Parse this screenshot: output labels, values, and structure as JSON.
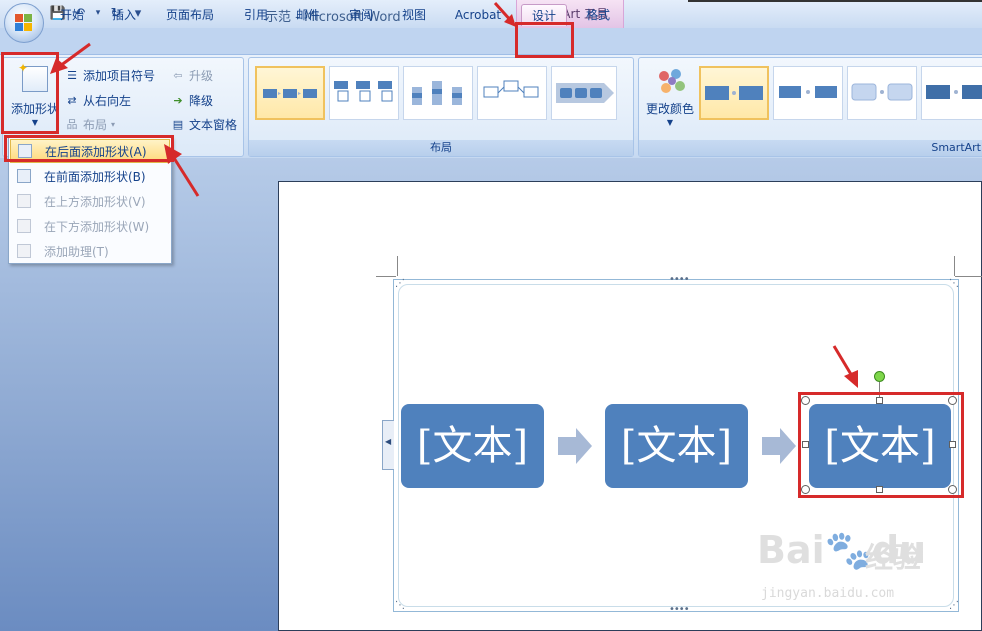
{
  "window": {
    "title": "示范 - Microsoft Word",
    "context_tool": "SmartArt 工具"
  },
  "qat": {
    "save": "💾",
    "undo": "↶",
    "redo": "↻",
    "customize": "▾"
  },
  "tabs": [
    "开始",
    "插入",
    "页面布局",
    "引用",
    "邮件",
    "审阅",
    "视图",
    "Acrobat",
    "设计",
    "格式"
  ],
  "active_tab": "设计",
  "ribbon": {
    "create_graphic": {
      "add_shape": "添加形状",
      "add_bullet": "添加项目符号",
      "right_to_left": "从右向左",
      "layout": "布局",
      "promote": "升级",
      "demote": "降级",
      "text_pane": "文本窗格"
    },
    "layouts_group": "布局",
    "change_colors": "更改颜色",
    "styles_group": "SmartArt"
  },
  "dropdown": {
    "items": [
      {
        "label": "在后面添加形状(A)",
        "enabled": true
      },
      {
        "label": "在前面添加形状(B)",
        "enabled": true
      },
      {
        "label": "在上方添加形状(V)",
        "enabled": false
      },
      {
        "label": "在下方添加形状(W)",
        "enabled": false
      },
      {
        "label": "添加助理(T)",
        "enabled": false
      }
    ]
  },
  "smartart": {
    "boxes": [
      "[文本]",
      "[文本]",
      "[文本]"
    ],
    "box_color": "#4f81bd",
    "arrow_color": "#a7b9d6"
  },
  "annotation_color": "#d62a2a",
  "watermark": {
    "logo": "Bai🐾du",
    "brand": "经验",
    "url": "jingyan.baidu.com"
  }
}
